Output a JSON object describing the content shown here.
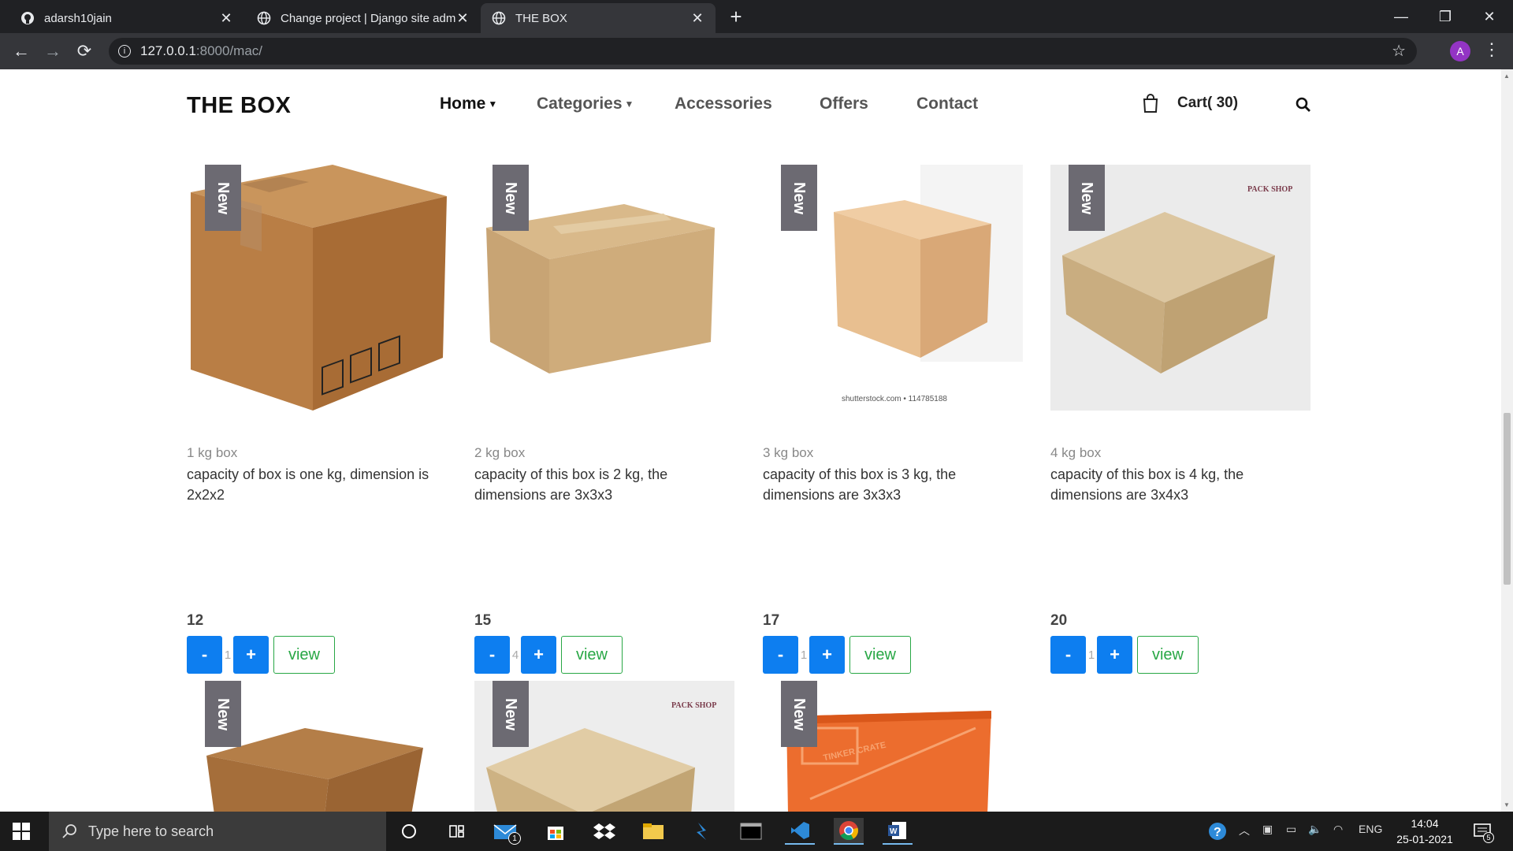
{
  "browser": {
    "tabs": [
      {
        "title": "adarsh10jain",
        "icon": "github-icon",
        "active": false
      },
      {
        "title": "Change project | Django site admin",
        "icon": "globe-icon",
        "active": false
      },
      {
        "title": "THE BOX",
        "icon": "globe-icon",
        "active": true
      }
    ],
    "address": {
      "host": "127.0.0.1",
      "path": ":8000/mac/"
    },
    "profile_initial": "A"
  },
  "site": {
    "brand": "THE BOX",
    "nav": [
      {
        "label": "Home",
        "dropdown": true,
        "active": true
      },
      {
        "label": "Categories",
        "dropdown": true,
        "active": false
      },
      {
        "label": "Accessories",
        "dropdown": false,
        "active": false
      },
      {
        "label": "Offers",
        "dropdown": false,
        "active": false
      },
      {
        "label": "Contact",
        "dropdown": false,
        "active": false
      }
    ],
    "cart_label": "Cart( 30)"
  },
  "products": [
    {
      "badge": "New",
      "name": "1 kg box",
      "description": "capacity of box is one kg, dimension is 2x2x2",
      "price": "12",
      "qty": "1",
      "minus": "-",
      "plus": "+",
      "view": "view"
    },
    {
      "badge": "New",
      "name": "2 kg box",
      "description": "capacity of this box is 2 kg, the dimensions are 3x3x3",
      "price": "15",
      "qty": "4",
      "minus": "-",
      "plus": "+",
      "view": "view"
    },
    {
      "badge": "New",
      "name": "3 kg box",
      "description": "capacity of this box is 3 kg, the dimensions are 3x3x3",
      "price": "17",
      "qty": "1",
      "minus": "-",
      "plus": "+",
      "view": "view",
      "watermark": "shutterstock.com • 114785188"
    },
    {
      "badge": "New",
      "name": "4 kg box",
      "description": "capacity of this box is 4 kg, the dimensions are 3x4x3",
      "price": "20",
      "qty": "1",
      "minus": "-",
      "plus": "+",
      "view": "view",
      "logo": "PACK SHOP"
    },
    {
      "badge": "New"
    },
    {
      "badge": "New",
      "logo": "PACK SHOP"
    },
    {
      "badge": "New",
      "logo": "TINKER CRATE"
    }
  ],
  "taskbar": {
    "search_placeholder": "Type here to search",
    "language": "ENG",
    "time": "14:04",
    "date": "25-01-2021",
    "mail_badge": "1",
    "notifications": "5"
  },
  "colors": {
    "accent_blue": "#0d7ef0",
    "view_green": "#28a745",
    "badge_gray": "#6c6a72"
  }
}
